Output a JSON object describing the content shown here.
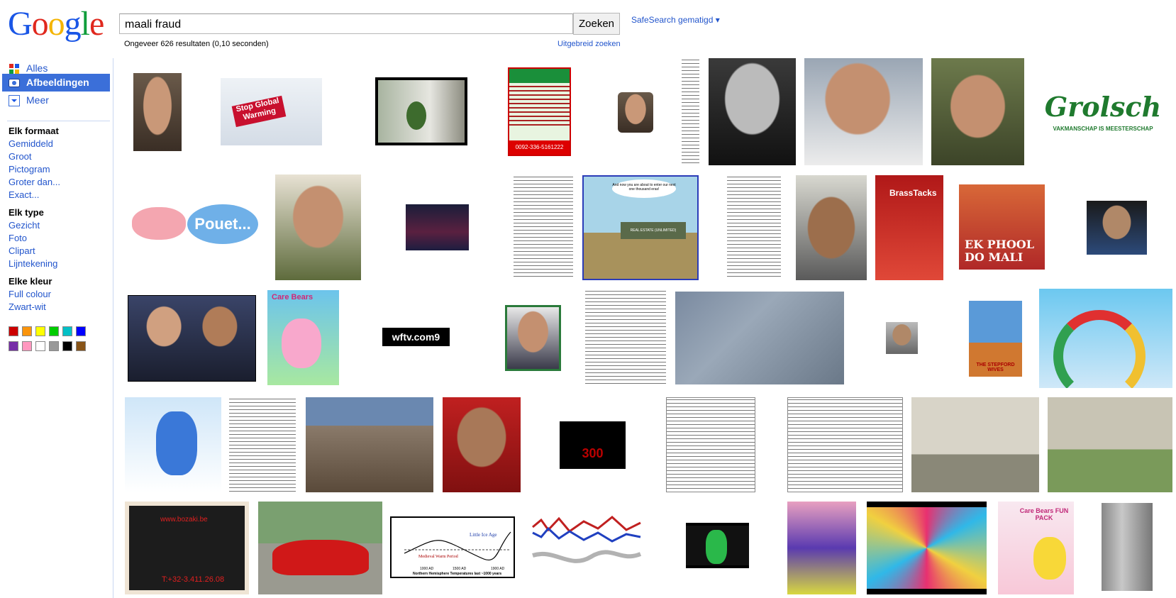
{
  "logo": {
    "letters": [
      "G",
      "o",
      "o",
      "g",
      "l",
      "e"
    ],
    "colors": [
      "#1a56e6",
      "#e0281e",
      "#f4b400",
      "#1a56e6",
      "#109d3b",
      "#e0281e"
    ]
  },
  "search": {
    "query": "maali fraud",
    "button_label": "Zoeken"
  },
  "safesearch": {
    "label": "SafeSearch gematigd ▾"
  },
  "result_stats": "Ongeveer 626 resultaten (0,10 seconden)",
  "advanced_search": "Uitgebreid zoeken",
  "sidebar": {
    "nav": [
      {
        "label": "Alles",
        "icon": "all-results-icon"
      },
      {
        "label": "Afbeeldingen",
        "icon": "images-icon",
        "selected": true
      },
      {
        "label": "Meer",
        "icon": "more-chevron-icon"
      }
    ],
    "size_heading": "Elk formaat",
    "size_options": [
      "Gemiddeld",
      "Groot",
      "Pictogram",
      "Groter dan...",
      "Exact..."
    ],
    "type_heading": "Elk type",
    "type_options": [
      "Gezicht",
      "Foto",
      "Clipart",
      "Lijntekening"
    ],
    "color_heading": "Elke kleur",
    "color_options": [
      "Full colour",
      "Zwart-wit"
    ],
    "color_swatches": [
      "#cc0000",
      "#fb940b",
      "#ffff00",
      "#00cc00",
      "#03c0c6",
      "#0000ff",
      "#762ca7",
      "#ff98bf",
      "#ffffff",
      "#999999",
      "#000000",
      "#885418"
    ]
  },
  "thumbnails": [
    {
      "kind": "face"
    },
    {
      "kind": "sign",
      "text": "Stop Global Warming"
    },
    {
      "kind": "plant"
    },
    {
      "kind": "poster",
      "text": "0092-336-5161222"
    },
    {
      "kind": "face"
    },
    {
      "kind": "doc"
    },
    {
      "kind": "face_bw"
    },
    {
      "kind": "face"
    },
    {
      "kind": "face"
    },
    {
      "kind": "logo",
      "text": "Grolsch",
      "subtext": "VAKMANSCHAP IS MEESTERSCHAP"
    },
    {
      "kind": "pig",
      "text": "Pouet..."
    },
    {
      "kind": "face"
    },
    {
      "kind": "crowd"
    },
    {
      "kind": "doc"
    },
    {
      "kind": "cartoon",
      "text": "REAL ESTATE (UNLIMITED)",
      "caption": "And now you are about to enter our next one thousand eras!"
    },
    {
      "kind": "doc"
    },
    {
      "kind": "face"
    },
    {
      "kind": "poster",
      "text": "BrassTacks"
    },
    {
      "kind": "poster",
      "text": "EK PHOOL DO MALI"
    },
    {
      "kind": "face"
    },
    {
      "kind": "face"
    },
    {
      "kind": "box",
      "text": "Care Bears"
    },
    {
      "kind": "logo",
      "text": "wftv.com9"
    },
    {
      "kind": "face"
    },
    {
      "kind": "doc"
    },
    {
      "kind": "aerial"
    },
    {
      "kind": "face"
    },
    {
      "kind": "poster",
      "text": "THE STEPFORD WIVES"
    },
    {
      "kind": "rainbow"
    },
    {
      "kind": "bear"
    },
    {
      "kind": "doc"
    },
    {
      "kind": "building"
    },
    {
      "kind": "face"
    },
    {
      "kind": "movie",
      "text": "300"
    },
    {
      "kind": "doc"
    },
    {
      "kind": "doc"
    },
    {
      "kind": "street"
    },
    {
      "kind": "street"
    },
    {
      "kind": "laptop",
      "text": "www.bozaki.be",
      "subtext": "T:+32-3.411.26.08"
    },
    {
      "kind": "car"
    },
    {
      "kind": "graph",
      "text": "Little Ice Age",
      "subtext": "Medieval Warm Period",
      "xaxis": "Northern Hemisphere Temperatures last ~1000 years",
      "ticks": [
        "1000 AD",
        "1500 AD",
        "1900 AD"
      ]
    },
    {
      "kind": "graph2"
    },
    {
      "kind": "ghost"
    },
    {
      "kind": "game"
    },
    {
      "kind": "game2"
    },
    {
      "kind": "box",
      "text": "Care Bears FUN PACK"
    },
    {
      "kind": "pc"
    }
  ]
}
